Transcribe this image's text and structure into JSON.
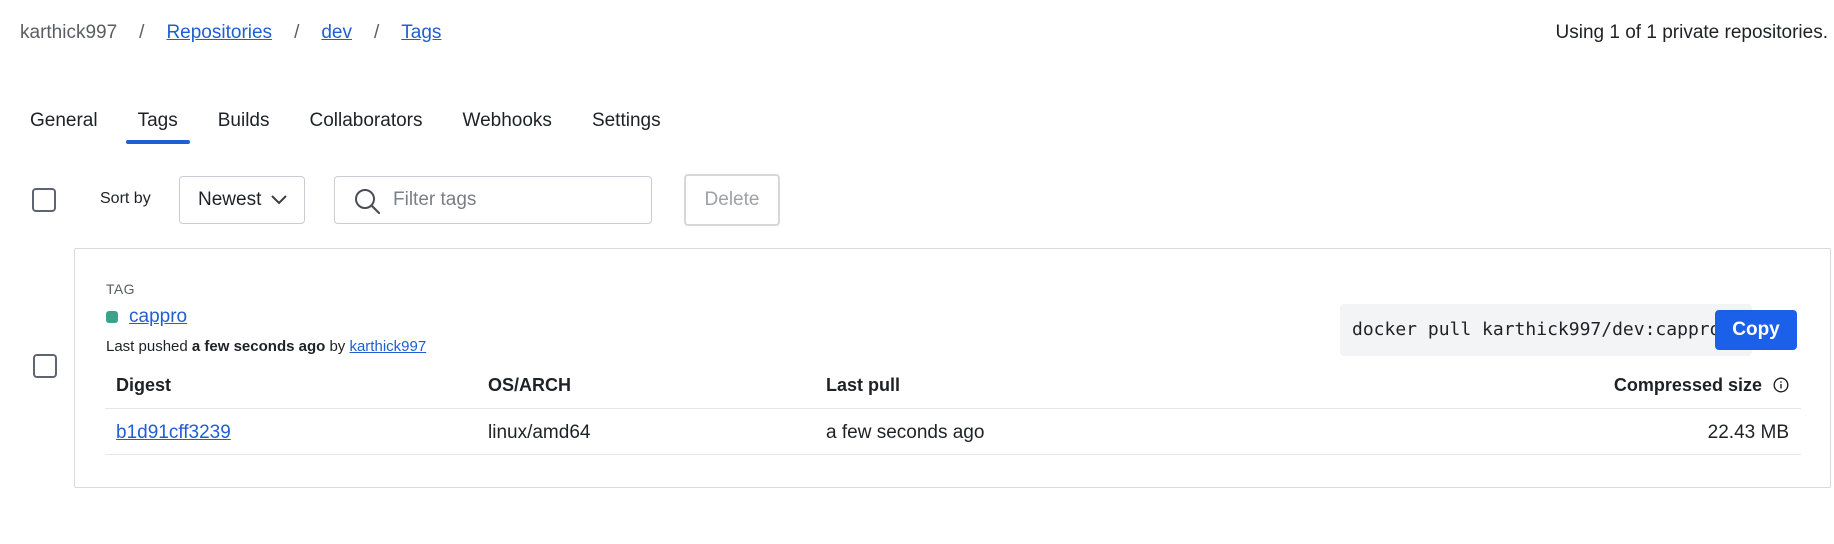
{
  "breadcrumb": {
    "user": "karthick997",
    "separator": "/",
    "repositories": "Repositories",
    "repo": "dev",
    "current": "Tags"
  },
  "usage_text": "Using 1 of 1 private repositories.",
  "tabs": [
    {
      "label": "General",
      "active": false
    },
    {
      "label": "Tags",
      "active": true
    },
    {
      "label": "Builds",
      "active": false
    },
    {
      "label": "Collaborators",
      "active": false
    },
    {
      "label": "Webhooks",
      "active": false
    },
    {
      "label": "Settings",
      "active": false
    }
  ],
  "toolbar": {
    "sort_label": "Sort by",
    "sort_value": "Newest",
    "filter_placeholder": "Filter tags",
    "delete_label": "Delete"
  },
  "tag_card": {
    "heading": "TAG",
    "tag_name": "cappro",
    "tag_status_color": "#3aa38a",
    "pushed_prefix": "Last pushed",
    "pushed_time": "a few seconds ago",
    "pushed_by": "by",
    "pushed_user": "karthick997",
    "pull_command": "docker pull karthick997/dev:cappro",
    "copy_label": "Copy",
    "table": {
      "headers": {
        "digest": "Digest",
        "os_arch": "OS/ARCH",
        "last_pull": "Last pull",
        "compressed_size": "Compressed size"
      },
      "rows": [
        {
          "digest": "b1d91cff3239",
          "os_arch": "linux/amd64",
          "last_pull": "a few seconds ago",
          "compressed_size": "22.43 MB"
        }
      ]
    }
  },
  "colors": {
    "accent": "#1f5fd1",
    "primary_button": "#1a60e8"
  }
}
